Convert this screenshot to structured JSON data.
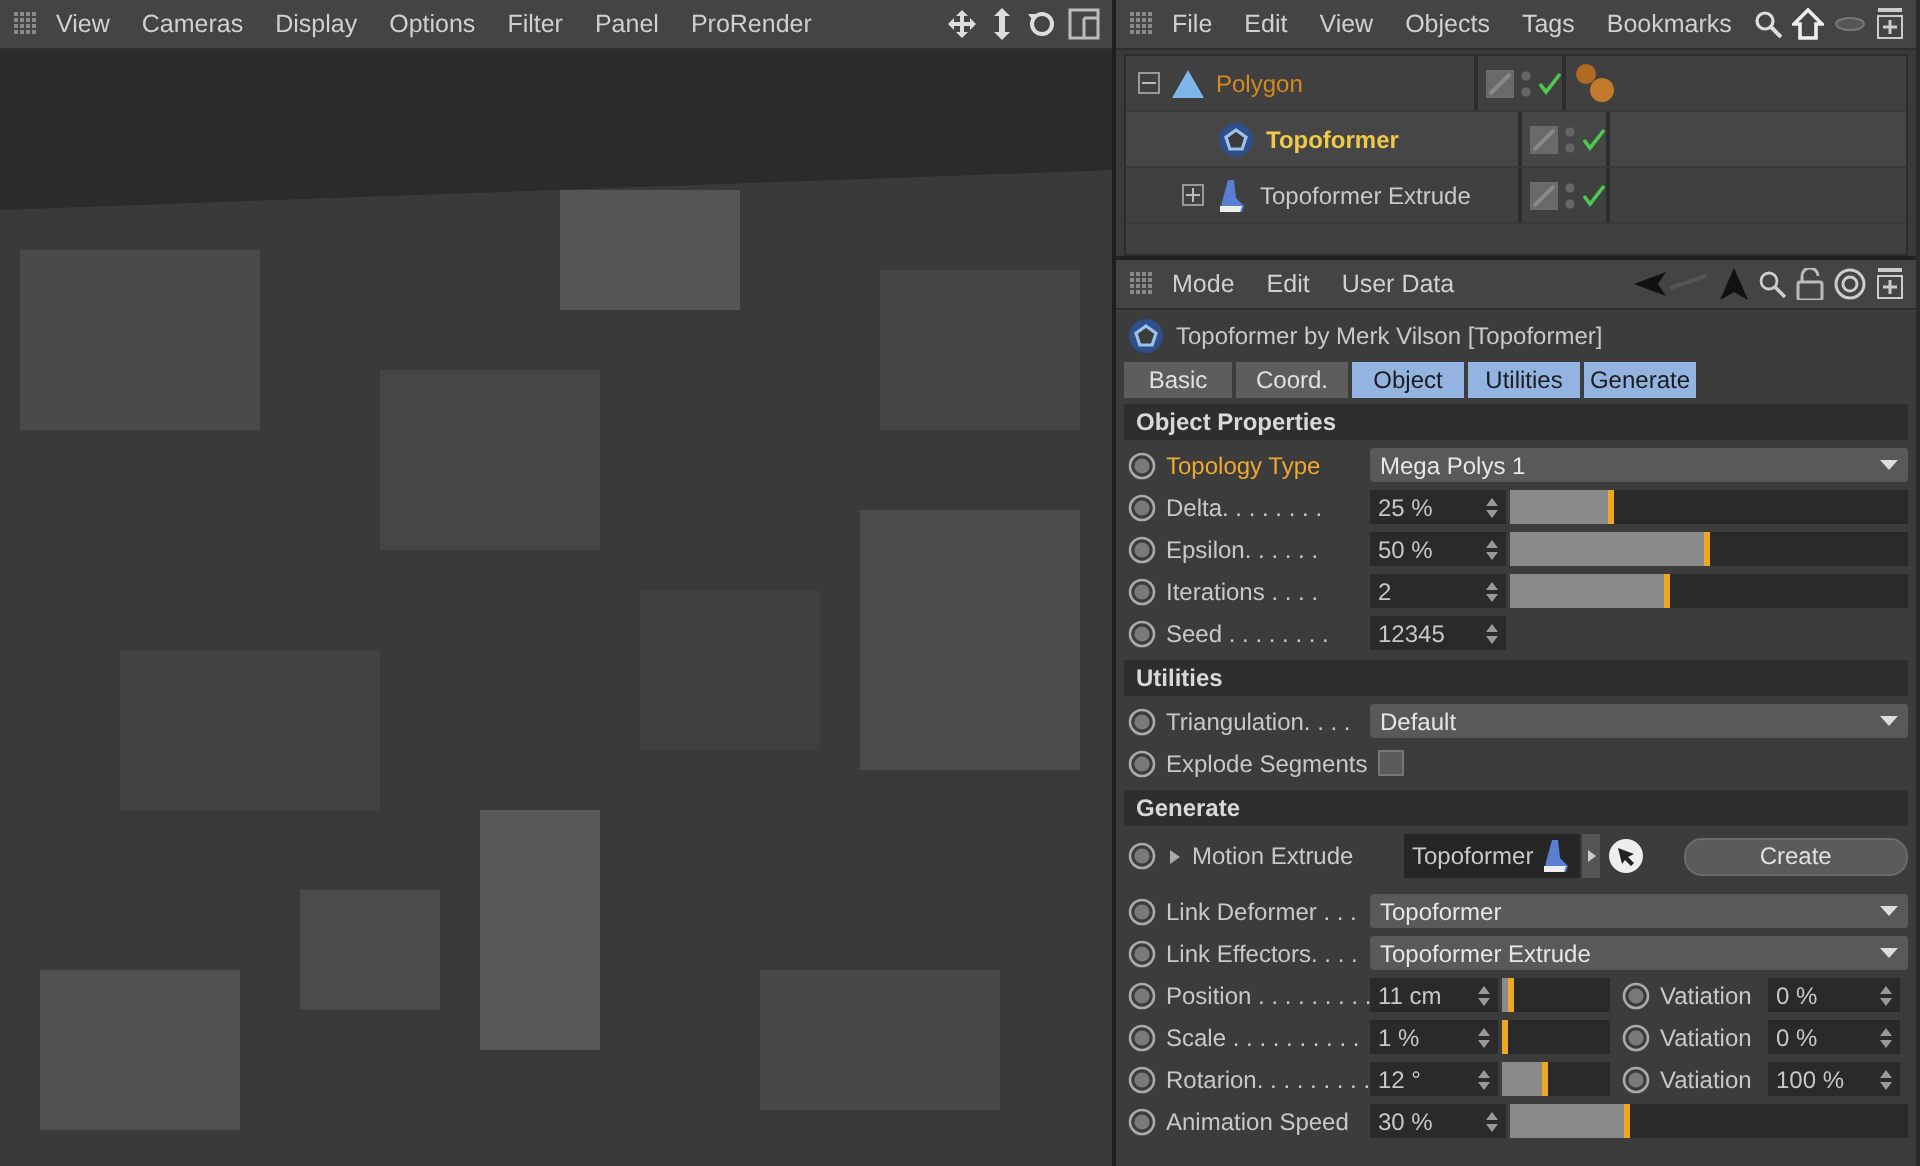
{
  "viewport": {
    "menu": [
      "View",
      "Cameras",
      "Display",
      "Options",
      "Filter",
      "Panel",
      "ProRender"
    ]
  },
  "object_manager": {
    "menu": [
      "File",
      "Edit",
      "View",
      "Objects",
      "Tags",
      "Bookmarks"
    ],
    "objects": [
      {
        "name": "Polygon",
        "kind": "polygon",
        "selected": true,
        "active": false,
        "has_material": true,
        "expanded": true,
        "children": [
          {
            "name": "Topoformer",
            "kind": "topoformer",
            "selected": false,
            "active": true,
            "has_material": false
          },
          {
            "name": "Topoformer Extrude",
            "kind": "extrude",
            "selected": false,
            "active": false,
            "has_material": false,
            "expanded": false
          }
        ]
      }
    ]
  },
  "attributes": {
    "menu": [
      "Mode",
      "Edit",
      "User Data"
    ],
    "title": "Topoformer by Merk Vilson [Topoformer]",
    "tabs": [
      {
        "label": "Basic",
        "selected": false
      },
      {
        "label": "Coord.",
        "selected": false
      },
      {
        "label": "Object",
        "selected": true
      },
      {
        "label": "Utilities",
        "selected": true
      },
      {
        "label": "Generate",
        "selected": true
      }
    ],
    "sections": [
      {
        "title": "Object Properties",
        "rows": [
          {
            "kind": "dropdown",
            "label": "Topology Type",
            "highlighted": true,
            "value": "Mega Polys 1"
          },
          {
            "kind": "slider",
            "label": "Delta. . . . . . . .",
            "highlighted": false,
            "value": "25 %",
            "level": 0.26
          },
          {
            "kind": "slider",
            "label": "Epsilon. . . . . .",
            "highlighted": false,
            "value": "50 %",
            "level": 0.5
          },
          {
            "kind": "slider",
            "label": "Iterations . . . .",
            "highlighted": false,
            "value": "2",
            "level": 0.4
          },
          {
            "kind": "number",
            "label": "Seed . . . . . . . .",
            "highlighted": false,
            "value": "12345"
          }
        ]
      },
      {
        "title": "Utilities",
        "rows": [
          {
            "kind": "dropdown",
            "label": "Triangulation. . . .",
            "highlighted": false,
            "value": "Default"
          },
          {
            "kind": "checkbox",
            "label": "Explode Segments",
            "highlighted": false,
            "checked": false
          }
        ]
      },
      {
        "title": "Generate",
        "rows": [
          {
            "kind": "link",
            "label": "Motion Extrude",
            "highlighted": false,
            "value": "Topoformer",
            "button": "Create"
          },
          {
            "kind": "dropdown",
            "label": "Link Deformer . . .",
            "highlighted": false,
            "value": "Topoformer"
          },
          {
            "kind": "dropdown",
            "label": "Link Effectors. . . .",
            "highlighted": false,
            "value": "Topoformer Extrude"
          },
          {
            "kind": "variation",
            "label": "Position . . . . . . . . .",
            "highlighted": false,
            "value": "11 cm",
            "level": 0.12,
            "variation_label": "Vatiation",
            "variation": "0 %"
          },
          {
            "kind": "variation",
            "label": "Scale . . . . . . . . . .",
            "highlighted": false,
            "value": "1 %",
            "level": 0.04,
            "variation_label": "Vatiation",
            "variation": "0 %"
          },
          {
            "kind": "variation",
            "label": "Rotarion. . . . . . . . .",
            "highlighted": false,
            "value": "12 °",
            "level": 0.42,
            "variation_label": "Vatiation",
            "variation": "100 %"
          },
          {
            "kind": "slider",
            "label": "Animation Speed",
            "highlighted": false,
            "value": "30 %",
            "level": 0.3
          }
        ]
      }
    ]
  }
}
